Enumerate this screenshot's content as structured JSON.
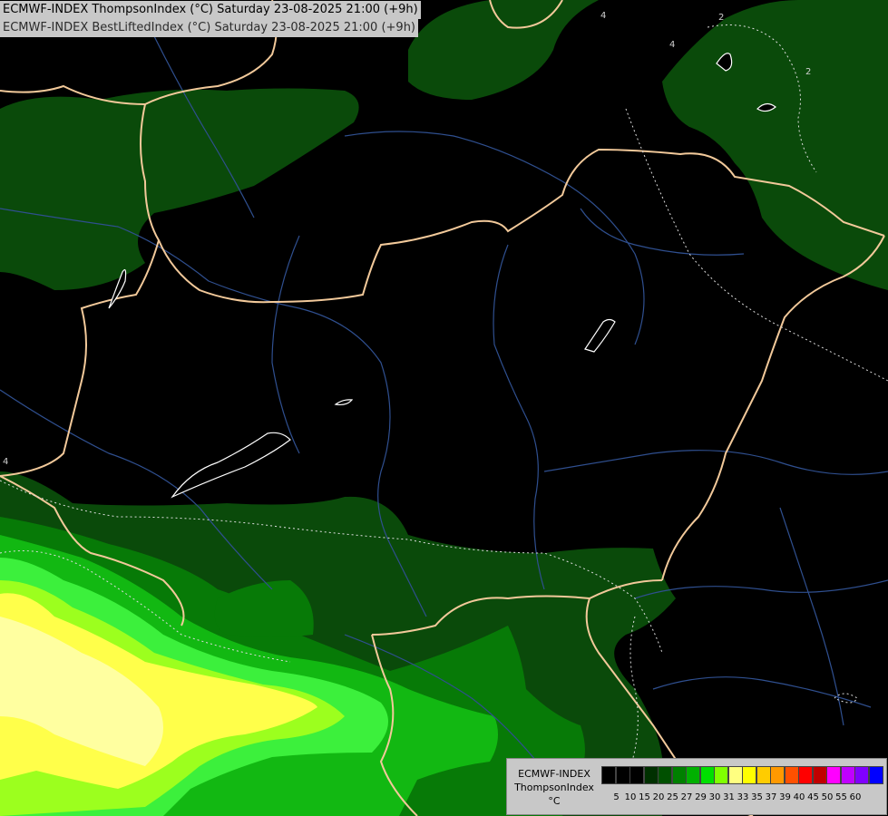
{
  "header": {
    "line1": "ECMWF-INDEX ThompsonIndex (°C) Saturday 23-08-2025 21:00 (+9h)",
    "line2": "ECMWF-INDEX BestLiftedIndex (°C) Saturday 23-08-2025 21:00 (+9h)"
  },
  "legend": {
    "line1": "ECMWF-INDEX",
    "line2": "ThompsonIndex",
    "unit": "°C",
    "ticks": [
      "5",
      "10",
      "15",
      "20",
      "25",
      "27",
      "29",
      "30",
      "31",
      "33",
      "35",
      "37",
      "39",
      "40",
      "45",
      "50",
      "55",
      "60"
    ],
    "colors": [
      "#000000",
      "#000000",
      "#000000",
      "#003000",
      "#005000",
      "#008000",
      "#00b000",
      "#00e000",
      "#80ff00",
      "#ffff80",
      "#ffff00",
      "#ffcc00",
      "#ff9900",
      "#ff5000",
      "#ff0000",
      "#c00000",
      "#ff00ff",
      "#c000ff",
      "#8000ff",
      "#0000ff"
    ]
  },
  "contour_labels": [
    "4",
    "2",
    "4",
    "2",
    "4"
  ]
}
